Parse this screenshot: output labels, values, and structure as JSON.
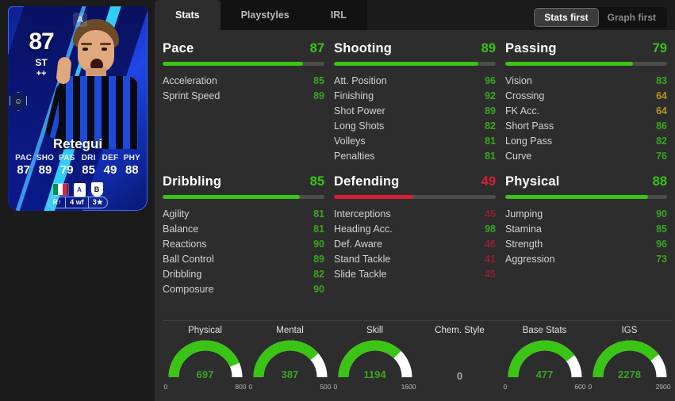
{
  "card": {
    "rating": "87",
    "position": "ST",
    "upgrade": "++",
    "name": "Retegui",
    "league_icon": "serie-a-icon",
    "evo_icon": "evolution-badge-icon",
    "attributes": [
      {
        "key": "PAC",
        "value": "87"
      },
      {
        "key": "SHO",
        "value": "89"
      },
      {
        "key": "PAS",
        "value": "79"
      },
      {
        "key": "DRI",
        "value": "85"
      },
      {
        "key": "DEF",
        "value": "49"
      },
      {
        "key": "PHY",
        "value": "88"
      }
    ],
    "nation_icon": "italy-flag-icon",
    "league_badge_icon": "serie-a-badge-icon",
    "club_badge_icon": "club-badge-icon",
    "skills": [
      "R↑",
      "4 wf",
      "3★"
    ]
  },
  "tabs": [
    {
      "label": "Stats",
      "active": true
    },
    {
      "label": "Playstyles",
      "active": false
    },
    {
      "label": "IRL",
      "active": false
    }
  ],
  "view_toggle": [
    {
      "label": "Stats first",
      "active": true
    },
    {
      "label": "Graph first",
      "active": false
    }
  ],
  "colors": {
    "green": "#3ac414",
    "green_text": "#3aa520",
    "yellow_text": "#b99415",
    "red": "#d41f36",
    "red_text": "#8e2130",
    "track": "#4d4d4d"
  },
  "groups": [
    {
      "name": "Pace",
      "value": "87",
      "pct": 87,
      "tone": "green",
      "stats": [
        {
          "label": "Acceleration",
          "value": "85",
          "tone": "green"
        },
        {
          "label": "Sprint Speed",
          "value": "89",
          "tone": "green"
        }
      ]
    },
    {
      "name": "Shooting",
      "value": "89",
      "pct": 89,
      "tone": "green",
      "stats": [
        {
          "label": "Att. Position",
          "value": "96",
          "tone": "green"
        },
        {
          "label": "Finishing",
          "value": "92",
          "tone": "green"
        },
        {
          "label": "Shot Power",
          "value": "89",
          "tone": "green"
        },
        {
          "label": "Long Shots",
          "value": "82",
          "tone": "green"
        },
        {
          "label": "Volleys",
          "value": "81",
          "tone": "green"
        },
        {
          "label": "Penalties",
          "value": "81",
          "tone": "green"
        }
      ]
    },
    {
      "name": "Passing",
      "value": "79",
      "pct": 79,
      "tone": "green",
      "stats": [
        {
          "label": "Vision",
          "value": "83",
          "tone": "green"
        },
        {
          "label": "Crossing",
          "value": "64",
          "tone": "yellow"
        },
        {
          "label": "FK Acc.",
          "value": "64",
          "tone": "yellow"
        },
        {
          "label": "Short Pass",
          "value": "86",
          "tone": "green"
        },
        {
          "label": "Long Pass",
          "value": "82",
          "tone": "green"
        },
        {
          "label": "Curve",
          "value": "76",
          "tone": "green"
        }
      ]
    },
    {
      "name": "Dribbling",
      "value": "85",
      "pct": 85,
      "tone": "green",
      "stats": [
        {
          "label": "Agility",
          "value": "81",
          "tone": "green"
        },
        {
          "label": "Balance",
          "value": "81",
          "tone": "green"
        },
        {
          "label": "Reactions",
          "value": "90",
          "tone": "green"
        },
        {
          "label": "Ball Control",
          "value": "89",
          "tone": "green"
        },
        {
          "label": "Dribbling",
          "value": "82",
          "tone": "green"
        },
        {
          "label": "Composure",
          "value": "90",
          "tone": "green"
        }
      ]
    },
    {
      "name": "Defending",
      "value": "49",
      "pct": 49,
      "tone": "red",
      "stats": [
        {
          "label": "Interceptions",
          "value": "45",
          "tone": "red"
        },
        {
          "label": "Heading Acc.",
          "value": "98",
          "tone": "green"
        },
        {
          "label": "Def. Aware",
          "value": "46",
          "tone": "red"
        },
        {
          "label": "Stand Tackle",
          "value": "41",
          "tone": "red"
        },
        {
          "label": "Slide Tackle",
          "value": "45",
          "tone": "red"
        }
      ]
    },
    {
      "name": "Physical",
      "value": "88",
      "pct": 88,
      "tone": "green",
      "stats": [
        {
          "label": "Jumping",
          "value": "90",
          "tone": "green"
        },
        {
          "label": "Stamina",
          "value": "85",
          "tone": "green"
        },
        {
          "label": "Strength",
          "value": "96",
          "tone": "green"
        },
        {
          "label": "Aggression",
          "value": "73",
          "tone": "green"
        }
      ]
    }
  ],
  "gauges": [
    {
      "title": "Physical",
      "value": "697",
      "min": "0",
      "max": "800",
      "pct": 87.1,
      "has_gauge": true
    },
    {
      "title": "Mental",
      "value": "387",
      "min": "0",
      "max": "500",
      "pct": 77.4,
      "has_gauge": true
    },
    {
      "title": "Skill",
      "value": "1194",
      "min": "0",
      "max": "1600",
      "pct": 74.6,
      "has_gauge": true
    },
    {
      "title": "Chem. Style",
      "value": "0",
      "min": "",
      "max": "",
      "pct": 0,
      "has_gauge": false
    },
    {
      "title": "Base Stats",
      "value": "477",
      "min": "0",
      "max": "600",
      "pct": 79.5,
      "has_gauge": true
    },
    {
      "title": "IGS",
      "value": "2278",
      "min": "0",
      "max": "2900",
      "pct": 78.6,
      "has_gauge": true
    }
  ]
}
